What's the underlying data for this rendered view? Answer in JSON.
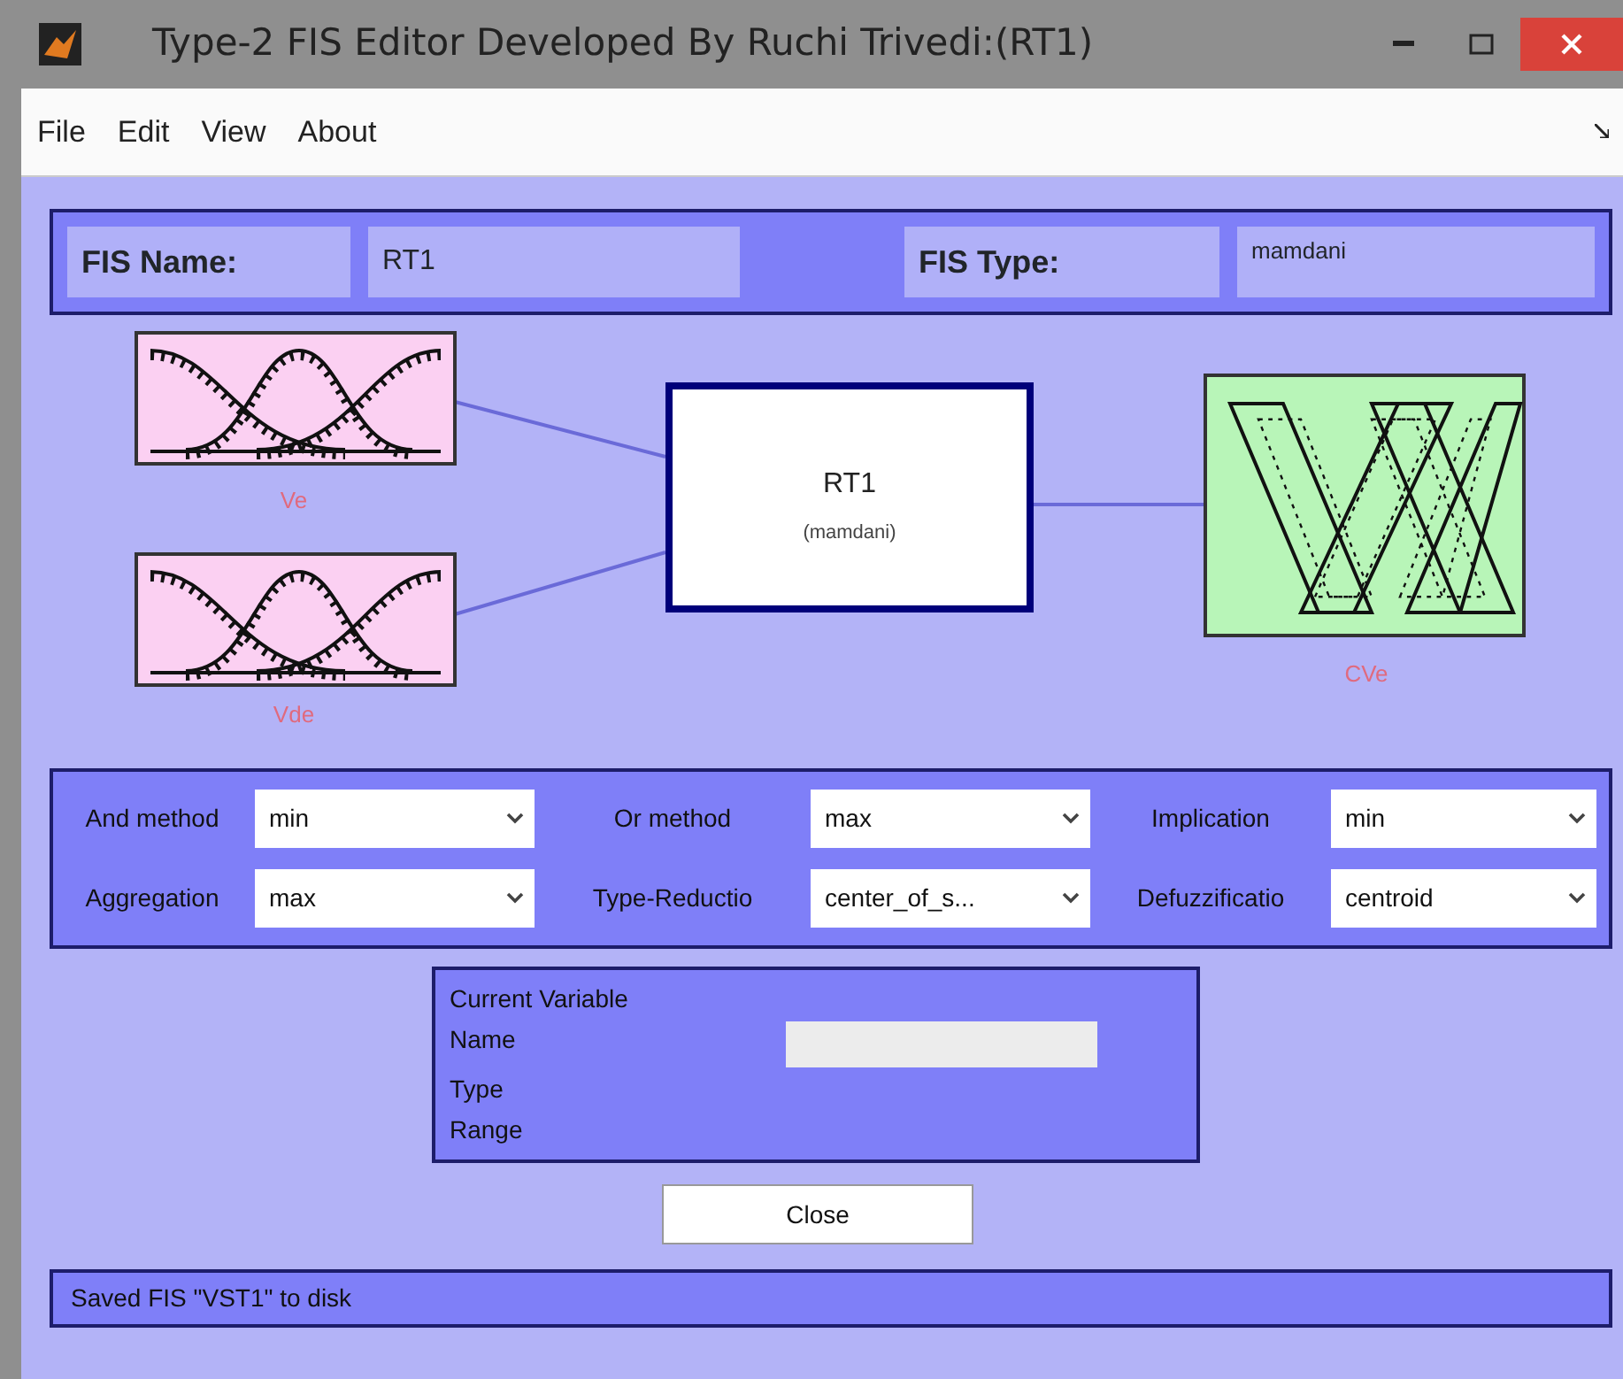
{
  "window": {
    "title": "Type-2 FIS Editor Developed By Ruchi Trivedi:(RT1)"
  },
  "menu": [
    "File",
    "Edit",
    "View",
    "About"
  ],
  "fis_name": {
    "label": "FIS Name:",
    "value": "RT1"
  },
  "fis_type": {
    "label": "FIS Type:",
    "value": "mamdani"
  },
  "diagram": {
    "inputs": [
      {
        "name": "Ve"
      },
      {
        "name": "Vde"
      }
    ],
    "system": {
      "name": "RT1",
      "type": "(mamdani)"
    },
    "outputs": [
      {
        "name": "CVe"
      }
    ]
  },
  "methods": [
    {
      "label": "And method",
      "value": "min"
    },
    {
      "label": "Or method",
      "value": "max"
    },
    {
      "label": "Implication",
      "value": "min"
    },
    {
      "label": "Aggregation",
      "value": "max"
    },
    {
      "label": "Type-Reductio",
      "value": "center_of_s..."
    },
    {
      "label": "Defuzzificatio",
      "value": "centroid"
    }
  ],
  "current_variable": {
    "title": "Current Variable",
    "fields": [
      "Name",
      "Type",
      "Range"
    ]
  },
  "buttons": [
    "Close"
  ],
  "status_bar": "Saved FIS \"VST1\" to disk"
}
